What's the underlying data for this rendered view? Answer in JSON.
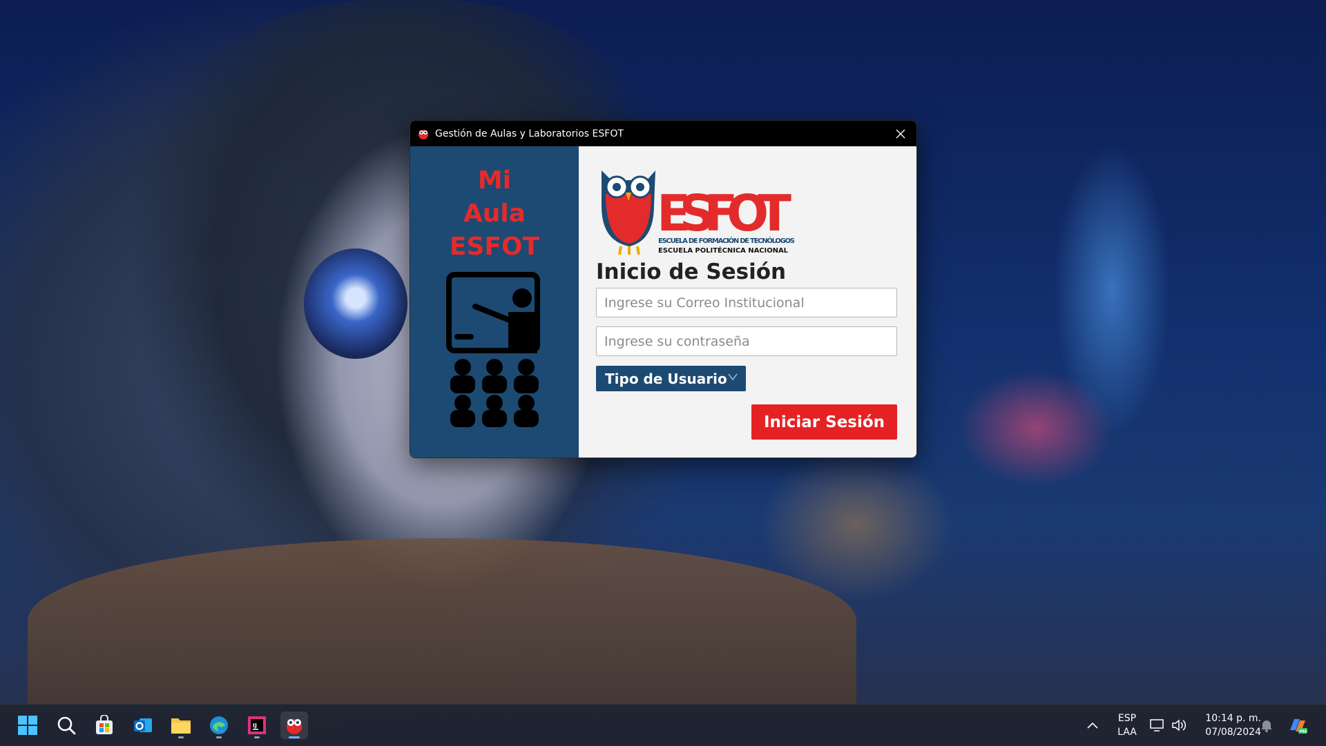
{
  "window": {
    "title": "Gestión de Aulas y Laboratorios ESFOT"
  },
  "left_panel": {
    "brand_lines": [
      "Mi",
      "Aula",
      "ESFOT"
    ],
    "icon": "classroom-teacher-icon"
  },
  "logo": {
    "name": "ESFOT",
    "line1": "ESCUELA DE FORMACIÓN DE TECNÓLOGOS",
    "line2": "ESCUELA POLITÉCNICA NACIONAL"
  },
  "form": {
    "title": "Inicio de Sesión",
    "email_placeholder": "Ingrese su Correo Institucional",
    "email_value": "",
    "password_placeholder": "Ingrese su contraseña",
    "password_value": "",
    "user_type_label": "Tipo de Usuario",
    "submit_label": "Iniciar Sesión"
  },
  "taskbar": {
    "items": [
      "start-icon",
      "search-icon",
      "store-icon",
      "outlook-icon",
      "file-explorer-icon",
      "edge-icon",
      "intellij-icon",
      "esfot-app-icon"
    ],
    "language_top": "ESP",
    "language_bottom": "LAA",
    "time": "10:14 p. m.",
    "date": "07/08/2024"
  },
  "colors": {
    "panel_blue": "#1c4a73",
    "accent_red": "#e62124",
    "brand_red": "#e32b2b"
  }
}
